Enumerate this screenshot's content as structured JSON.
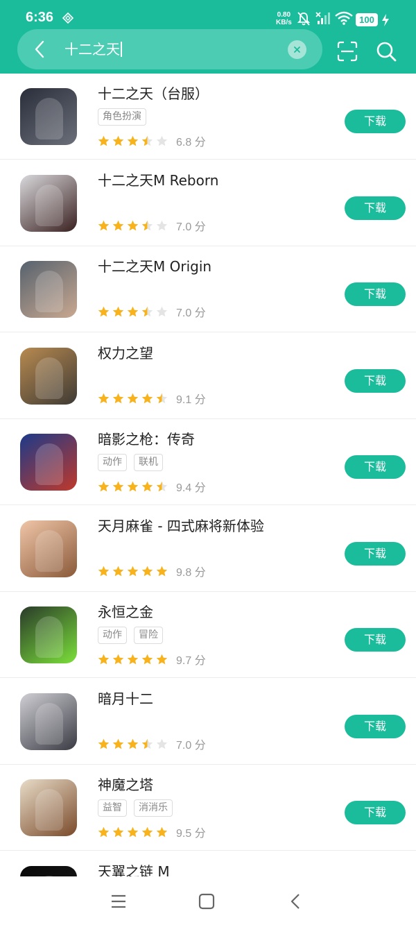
{
  "status_bar": {
    "time": "6:36",
    "net_speed_value": "0.80",
    "net_speed_unit": "KB/s",
    "battery": "100",
    "icons": [
      "nfc-icon",
      "mute-icon",
      "signal-icon",
      "wifi-icon",
      "battery-icon",
      "charging-icon"
    ]
  },
  "search": {
    "query": "十二之天",
    "icons": [
      "back-icon",
      "clear-icon",
      "scan-icon",
      "search-icon"
    ]
  },
  "colors": {
    "accent": "#1bbc9b",
    "star": "#f8b31c",
    "star_empty": "#e4e4e4"
  },
  "results": [
    {
      "name": "十二之天（台服）",
      "tags": [
        "角色扮演"
      ],
      "stars": 3.5,
      "score": "6.8 分",
      "button": "下载",
      "icon_colors": [
        "#2a2e3a",
        "#6b6f7a"
      ]
    },
    {
      "name": "十二之天M Reborn",
      "tags": [],
      "stars": 3.5,
      "score": "7.0 分",
      "button": "下载",
      "icon_colors": [
        "#d9d9dc",
        "#3a2020"
      ]
    },
    {
      "name": "十二之天M Origin",
      "tags": [],
      "stars": 3.5,
      "score": "7.0 分",
      "button": "下载",
      "icon_colors": [
        "#56626e",
        "#c9a890"
      ]
    },
    {
      "name": "权力之望",
      "tags": [],
      "stars": 4.5,
      "score": "9.1 分",
      "button": "下载",
      "icon_colors": [
        "#b88a50",
        "#3e3a34"
      ]
    },
    {
      "name": "暗影之枪：传奇",
      "tags": [
        "动作",
        "联机"
      ],
      "stars": 4.5,
      "score": "9.4 分",
      "button": "下载",
      "icon_colors": [
        "#1c3a8a",
        "#c0392b"
      ]
    },
    {
      "name": "天月麻雀 - 四式麻将新体验",
      "tags": [],
      "stars": 5,
      "score": "9.8 分",
      "button": "下载",
      "icon_colors": [
        "#f0c6a8",
        "#8a5a3a"
      ]
    },
    {
      "name": "永恒之金",
      "tags": [
        "动作",
        "冒险"
      ],
      "stars": 5,
      "score": "9.7 分",
      "button": "下载",
      "icon_colors": [
        "#2a3a2a",
        "#7be03a"
      ]
    },
    {
      "name": "暗月十二",
      "tags": [],
      "stars": 3.5,
      "score": "7.0 分",
      "button": "下载",
      "icon_colors": [
        "#cfcfd4",
        "#3a3a44"
      ]
    },
    {
      "name": "神魔之塔",
      "tags": [
        "益智",
        "消消乐"
      ],
      "stars": 5,
      "score": "9.5 分",
      "button": "下载",
      "icon_colors": [
        "#e8dcc8",
        "#7a4a2a"
      ]
    },
    {
      "name": "天翼之链 M",
      "tags": [],
      "stars": 0,
      "score": "",
      "button": "",
      "icon_colors": [
        "#0a0a0a",
        "#1a1a1a"
      ]
    }
  ],
  "nav_bar": {
    "icons": [
      "menu-icon",
      "home-icon",
      "back-nav-icon"
    ]
  }
}
